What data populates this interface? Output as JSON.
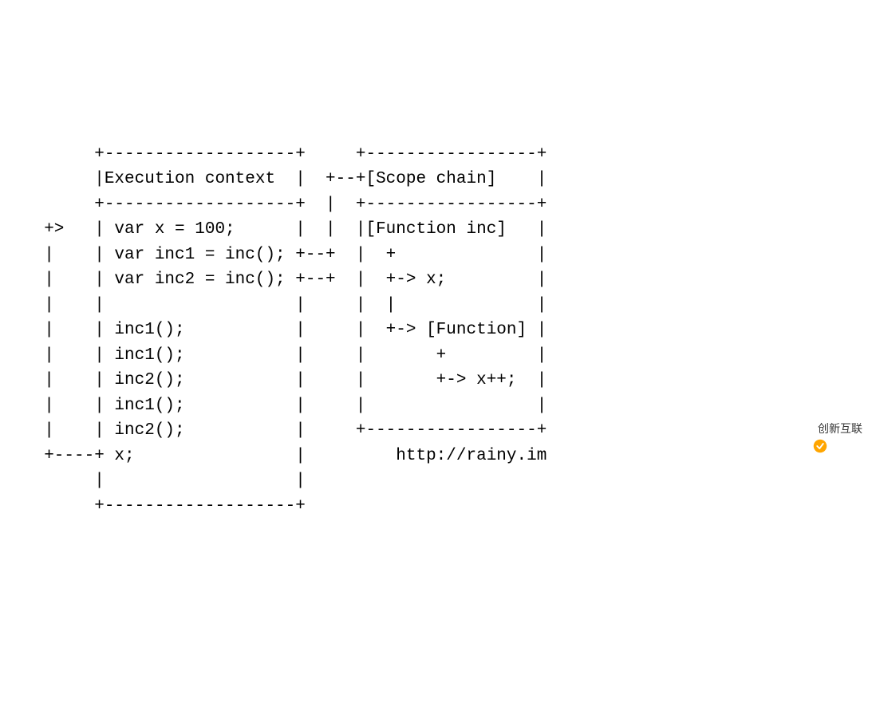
{
  "diagram": {
    "lines": [
      "       +-------------------+     +-----------------+",
      "       |Execution context  |  +--+[Scope chain]    |",
      "       +-------------------+  |  +-----------------+",
      "  +>   | var x = 100;      |  |  |[Function inc]   |",
      "  |    | var inc1 = inc(); +--+  |  +              |",
      "  |    | var inc2 = inc(); +--+  |  +-> x;         |",
      "  |    |                   |     |  |              |",
      "  |    | inc1();           |     |  +-> [Function] |",
      "  |    | inc1();           |     |       +         |",
      "  |    | inc2();           |     |       +-> x++;  |",
      "  |    | inc1();           |     |                 |",
      "  |    | inc2();           |     +-----------------+",
      "  +----+ x;                |         http://rainy.im",
      "       |                   |",
      "       +-------------------+"
    ]
  },
  "watermark": {
    "text": "创新互联"
  }
}
